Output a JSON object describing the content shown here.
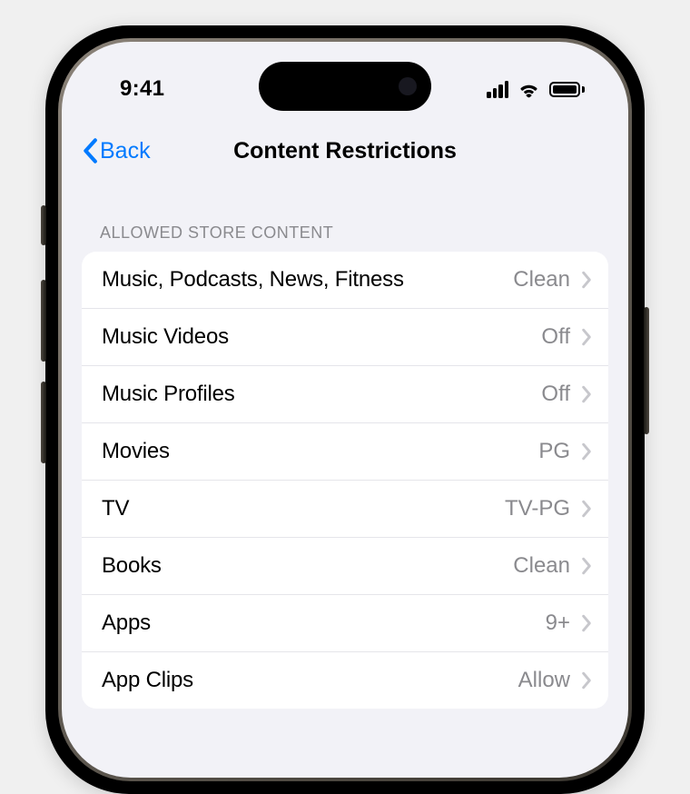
{
  "statusbar": {
    "time": "9:41"
  },
  "nav": {
    "back_label": "Back",
    "title": "Content Restrictions"
  },
  "section": {
    "header": "ALLOWED STORE CONTENT",
    "rows": [
      {
        "label": "Music, Podcasts, News, Fitness",
        "value": "Clean"
      },
      {
        "label": "Music Videos",
        "value": "Off"
      },
      {
        "label": "Music Profiles",
        "value": "Off"
      },
      {
        "label": "Movies",
        "value": "PG"
      },
      {
        "label": "TV",
        "value": "TV-PG"
      },
      {
        "label": "Books",
        "value": "Clean"
      },
      {
        "label": "Apps",
        "value": "9+"
      },
      {
        "label": "App Clips",
        "value": "Allow"
      }
    ]
  }
}
